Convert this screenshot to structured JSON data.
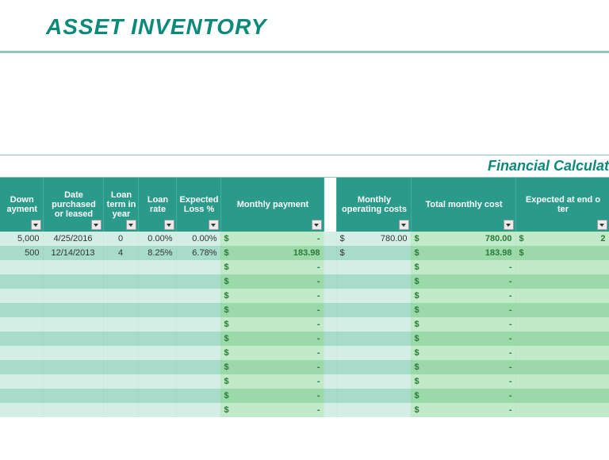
{
  "title": "ASSET INVENTORY",
  "financialHeader": "Financial Calculat",
  "columns": {
    "c0": "Down ayment",
    "c1": "Date purchased or leased",
    "c2": "Loan term in year",
    "c3": "Loan rate",
    "c4": "Expected Loss %",
    "c5": "Monthly payment",
    "c6": "",
    "c7": "Monthly operating costs",
    "c8": "Total monthly cost",
    "c9": "Expected at end o ter"
  },
  "chart_data": {
    "type": "table",
    "columns": [
      "Down payment",
      "Date purchased or leased",
      "Loan term in years",
      "Loan rate",
      "Expected Loss %",
      "Monthly payment",
      "Monthly operating costs",
      "Total monthly cost",
      "Expected at end of term"
    ],
    "rows": [
      {
        "down": 5000,
        "date": "4/25/2016",
        "term": 0,
        "rate": "0.00%",
        "loss": "0.00%",
        "monthly": "-",
        "op": 780.0,
        "total": 780.0,
        "end": 2
      },
      {
        "down": 500,
        "date": "12/14/2013",
        "term": 4,
        "rate": "8.25%",
        "loss": "6.78%",
        "monthly": 183.98,
        "op": null,
        "total": 183.98,
        "end": null
      }
    ]
  },
  "rows": [
    {
      "c0": "5,000",
      "c1": "4/25/2016",
      "c2": "0",
      "c3": "0.00%",
      "c4": "0.00%",
      "c5": "-",
      "c7": "780.00",
      "c8": "780.00",
      "c9": "2"
    },
    {
      "c0": "500",
      "c1": "12/14/2013",
      "c2": "4",
      "c3": "8.25%",
      "c4": "6.78%",
      "c5": "183.98",
      "c7": "",
      "c8": "183.98",
      "c9": ""
    },
    {
      "c5": "-",
      "c8": "-"
    },
    {
      "c5": "-",
      "c8": "-"
    },
    {
      "c5": "-",
      "c8": "-"
    },
    {
      "c5": "-",
      "c8": "-"
    },
    {
      "c5": "-",
      "c8": "-"
    },
    {
      "c5": "-",
      "c8": "-"
    },
    {
      "c5": "-",
      "c8": "-"
    },
    {
      "c5": "-",
      "c8": "-"
    },
    {
      "c5": "-",
      "c8": "-"
    },
    {
      "c5": "-",
      "c8": "-"
    },
    {
      "c5": "-",
      "c8": "-"
    }
  ],
  "dollar": "$"
}
